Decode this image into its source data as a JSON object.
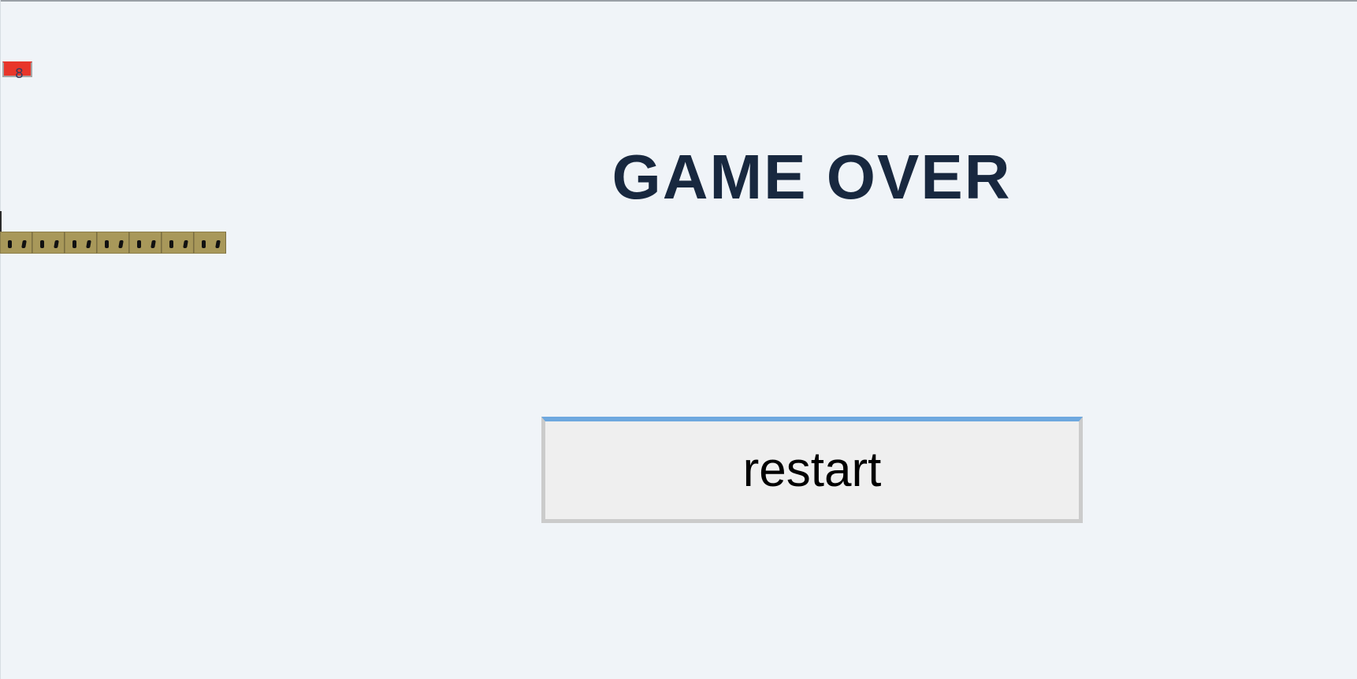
{
  "hud": {
    "score": "8",
    "score_color": "#e8352a"
  },
  "snake": {
    "segment_count": 7,
    "segment_color": "#a8985a"
  },
  "game_over": {
    "title": "GAME OVER",
    "restart_label": "restart",
    "title_color": "#18283f"
  }
}
